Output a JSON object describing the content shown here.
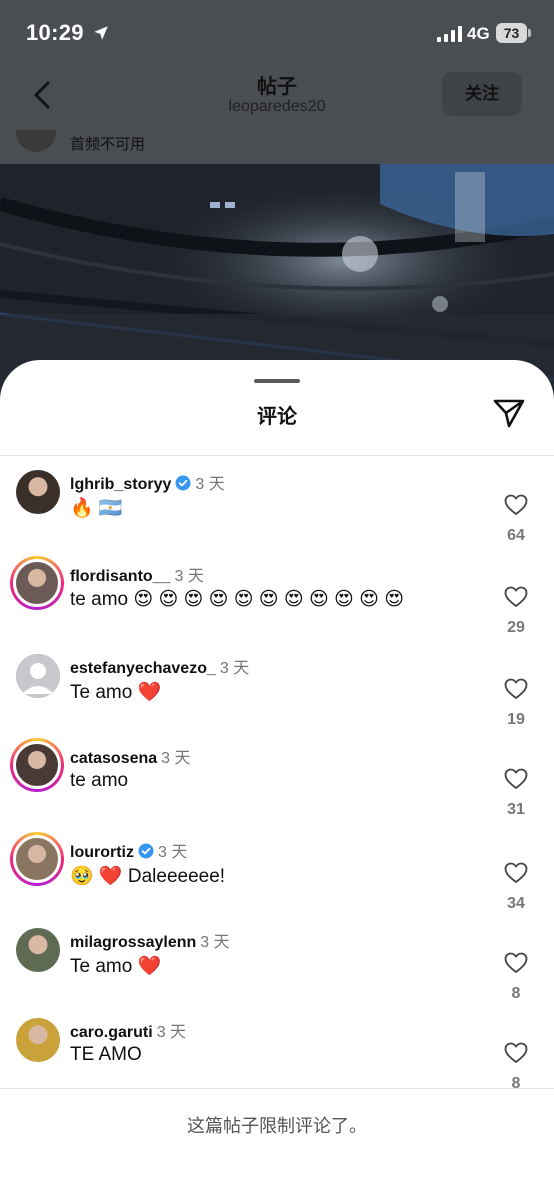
{
  "status": {
    "time": "10:29",
    "network": "4G",
    "battery": "73"
  },
  "nav": {
    "title": "帖子",
    "subtitle": "leoparedes20",
    "follow_label": "关注"
  },
  "caption_text": "首频不可用",
  "sheet": {
    "title": "评论",
    "footer_note": "这篇帖子限制评论了。"
  },
  "comments": [
    {
      "user": "lghrib_storyy",
      "verified": true,
      "time": "3 天",
      "text": "🔥 🇦🇷",
      "likes": "64",
      "ring": false
    },
    {
      "user": "flordisanto__",
      "verified": false,
      "time": "3 天",
      "text": "te amo 😍 😍 😍 😍 😍 😍 😍 😍 😍 😍 😍",
      "likes": "29",
      "ring": true
    },
    {
      "user": "estefanyechavezo_",
      "verified": false,
      "time": "3 天",
      "text": "Te amo ❤️",
      "likes": "19",
      "ring": false
    },
    {
      "user": "catasosena",
      "verified": false,
      "time": "3 天",
      "text": "te amo",
      "likes": "31",
      "ring": true
    },
    {
      "user": "lourortiz",
      "verified": true,
      "time": "3 天",
      "text": "🥹 ❤️ Daleeeeee!",
      "likes": "34",
      "ring": true
    },
    {
      "user": "milagrossaylenn",
      "verified": false,
      "time": "3 天",
      "text": "Te amo ❤️",
      "likes": "8",
      "ring": false
    },
    {
      "user": "caro.garuti",
      "verified": false,
      "time": "3 天",
      "text": "TE AMO",
      "likes": "8",
      "ring": false
    }
  ],
  "colors": {
    "verified": "#3797f0",
    "like_count": "#777777",
    "heart_red": "#e0245e"
  }
}
